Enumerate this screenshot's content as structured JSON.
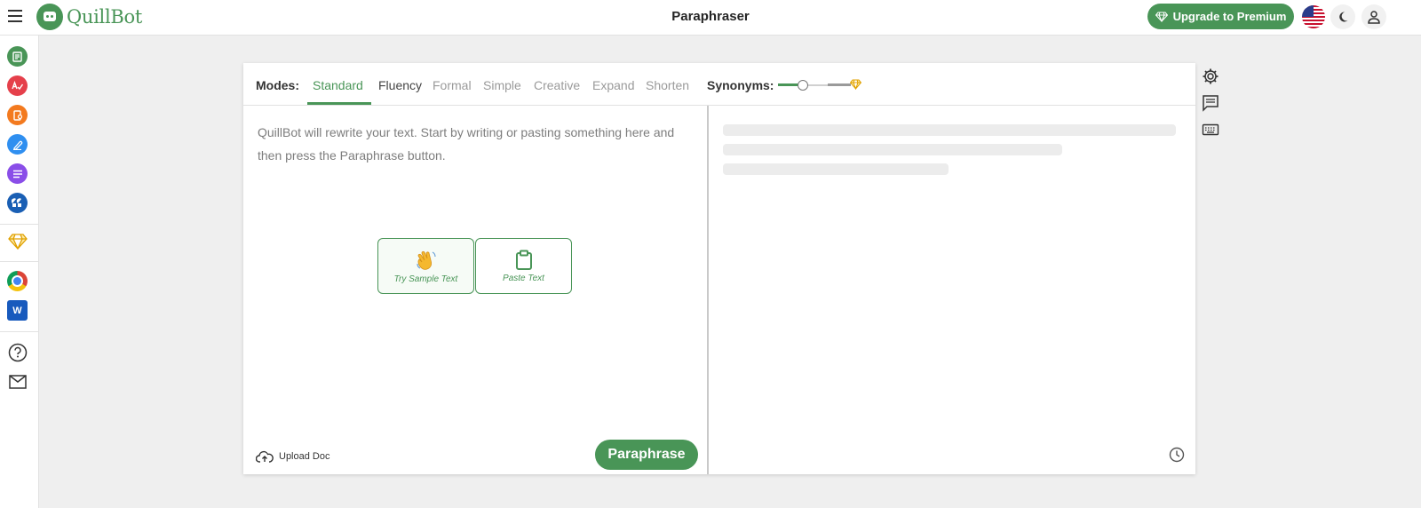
{
  "app": {
    "logo_text": "QuillBot",
    "page_title": "Paraphraser"
  },
  "header": {
    "upgrade_label": "Upgrade to Premium",
    "icons": [
      "menu-icon",
      "flag-us-icon",
      "moon-icon",
      "user-icon"
    ]
  },
  "sidebar": {
    "items": [
      "paraphraser-icon",
      "grammar-checker-icon",
      "plagiarism-checker-icon",
      "co-writer-icon",
      "summarizer-icon",
      "citation-generator-icon",
      "premium-diamond-icon",
      "chrome-extension-icon",
      "word-addin-icon",
      "help-icon",
      "mail-icon"
    ]
  },
  "modes": {
    "label": "Modes:",
    "tabs": [
      "Standard",
      "Fluency",
      "Formal",
      "Simple",
      "Creative",
      "Expand",
      "Shorten"
    ],
    "active": "Standard"
  },
  "synonyms": {
    "label": "Synonyms:",
    "level": 0.33
  },
  "input": {
    "placeholder": "QuillBot will rewrite your text. Start by writing or pasting something here and then press the Paraphrase button.",
    "sample_label": "Try Sample Text",
    "paste_label": "Paste Text",
    "upload_label": "Upload Doc",
    "paraphrase_label": "Paraphrase"
  },
  "colors": {
    "brand": "#499557",
    "background": "#efefef"
  }
}
